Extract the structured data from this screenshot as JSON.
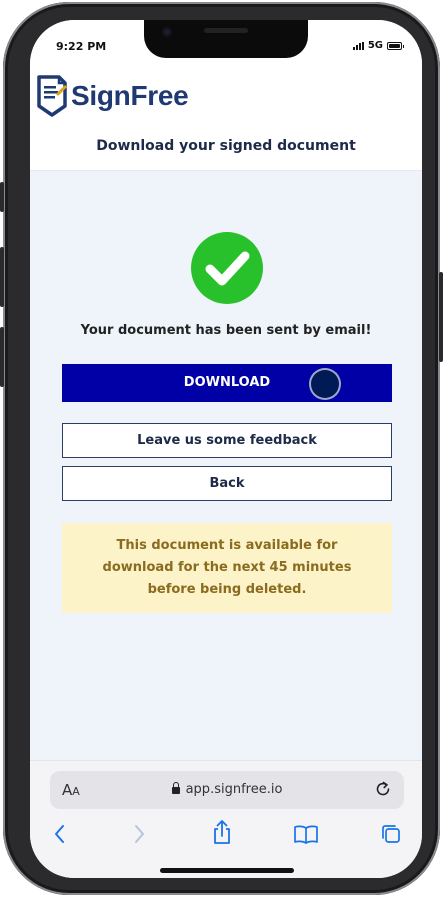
{
  "status_bar": {
    "time": "9:22 PM",
    "network": "5G"
  },
  "app": {
    "logo_text": "SignFree",
    "page_title": "Download your signed document"
  },
  "main": {
    "sent_message": "Your document has been sent by email!",
    "download_label": "DOWNLOAD",
    "feedback_label": "Leave us some feedback",
    "back_label": "Back",
    "notice_text": "This document is available for download for the next 45 minutes before being deleted."
  },
  "browser": {
    "aa_main": "A",
    "aa_small": "A",
    "url": "app.signfree.io"
  },
  "colors": {
    "brand_navy": "#1f3a73",
    "download_button": "#0000a6",
    "success_green": "#29c12b",
    "notice_bg": "#fdf3c8",
    "notice_text": "#8a6b1f"
  },
  "icons": [
    "logo-document-icon",
    "checkmark-icon",
    "lock-icon",
    "reload-icon",
    "back-icon",
    "forward-icon",
    "share-icon",
    "bookmarks-icon",
    "tabs-icon"
  ]
}
